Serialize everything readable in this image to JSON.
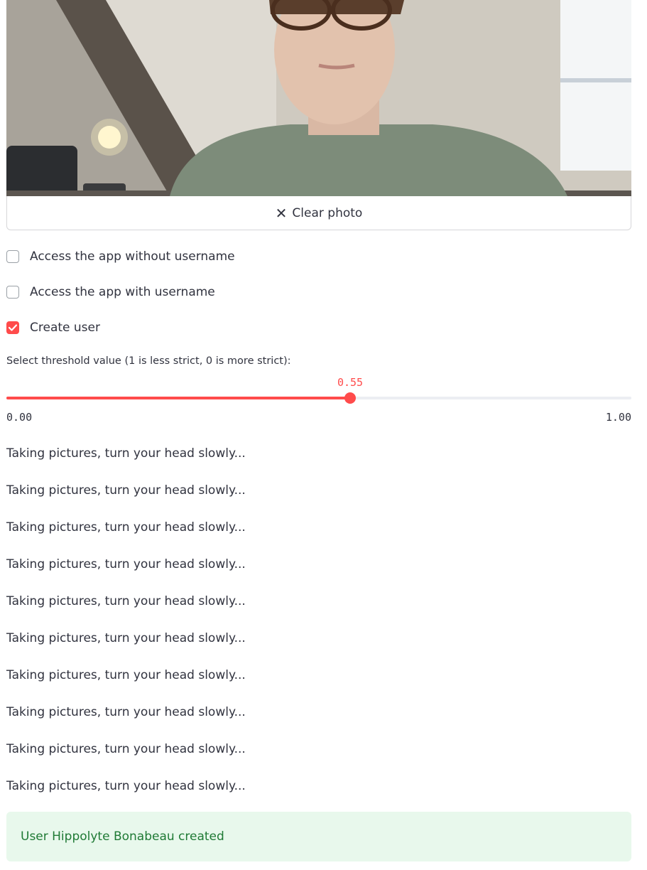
{
  "photo": {
    "clear_label": "Clear photo",
    "clear_icon": "x-icon"
  },
  "checkboxes": [
    {
      "label": "Access the app without username",
      "checked": false
    },
    {
      "label": "Access the app with username",
      "checked": false
    },
    {
      "label": "Create user",
      "checked": true
    }
  ],
  "slider": {
    "label": "Select threshold value (1 is less strict, 0 is more strict):",
    "value": "0.55",
    "value_fraction": 0.55,
    "min": "0.00",
    "max": "1.00"
  },
  "messages": [
    "Taking pictures, turn your head slowly...",
    "Taking pictures, turn your head slowly...",
    "Taking pictures, turn your head slowly...",
    "Taking pictures, turn your head slowly...",
    "Taking pictures, turn your head slowly...",
    "Taking pictures, turn your head slowly...",
    "Taking pictures, turn your head slowly...",
    "Taking pictures, turn your head slowly...",
    "Taking pictures, turn your head slowly...",
    "Taking pictures, turn your head slowly..."
  ],
  "success_message": "User Hippolyte Bonabeau created",
  "colors": {
    "accent": "#ff4b4b",
    "success_bg": "#e8f8ec",
    "success_text": "#1f7a35"
  }
}
